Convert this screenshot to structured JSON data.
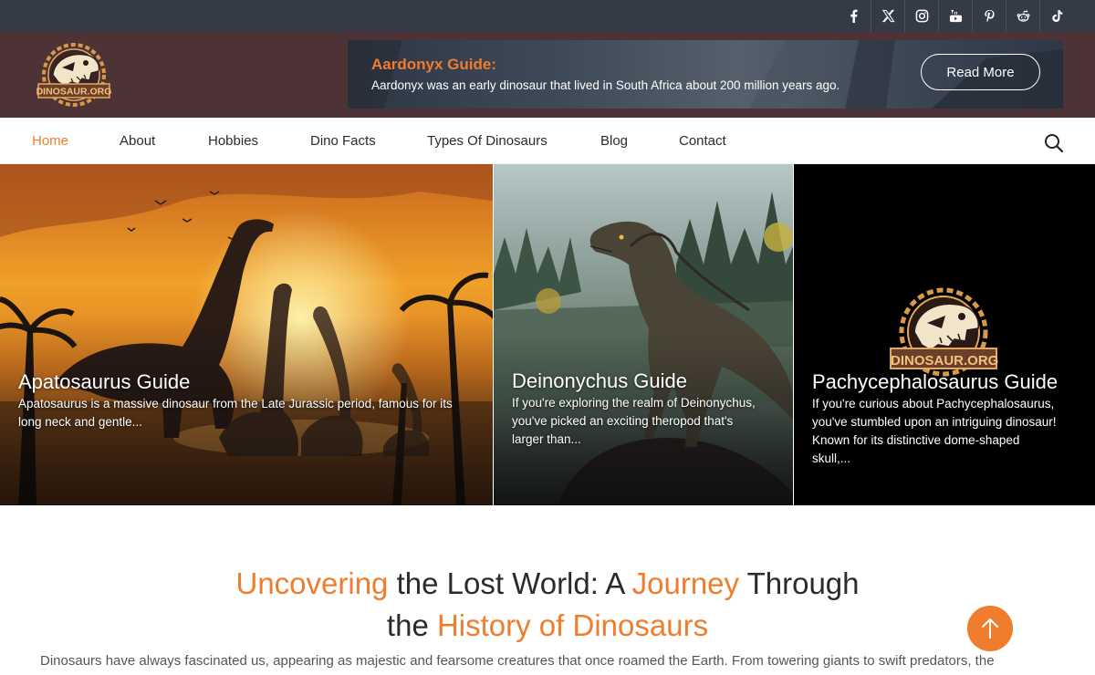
{
  "social": [
    "facebook-icon",
    "x-icon",
    "instagram-icon",
    "youtube-icon",
    "pinterest-icon",
    "reddit-icon",
    "tiktok-icon"
  ],
  "logo": {
    "text": "DINOSAUR.ORG"
  },
  "banner": {
    "title": "Aardonyx Guide:",
    "text": "Aardonyx was an early dinosaur that lived in South Africa about 200 million years ago.",
    "button": "Read More"
  },
  "nav": {
    "items": [
      "Home",
      "About",
      "Hobbies",
      "Dino Facts",
      "Types Of Dinosaurs",
      "Blog",
      "Contact"
    ],
    "active": "Home"
  },
  "cards": [
    {
      "title": "Apatosaurus Guide",
      "desc": "Apatosaurus is a massive dinosaur from the Late Jurassic period, famous for its long neck and gentle..."
    },
    {
      "title": "Deinonychus Guide",
      "desc": "If you're exploring the realm of Deinonychus, you've picked an exciting theropod that's larger than..."
    },
    {
      "title": "Pachycephalosaurus Guide",
      "desc": "If you're curious about Pachycephalosaurus, you've stumbled upon an intriguing dinosaur! Known for its distinctive dome-shaped skull,..."
    }
  ],
  "headline": {
    "part1": "Uncovering",
    "part2": " the Lost World: A ",
    "part3": "Journey",
    "part4": " Through",
    "part5": "the ",
    "part6": "History of Dinosaurs"
  },
  "intro": "Dinosaurs have always fascinated us, appearing as majestic and fearsome creatures that once roamed the Earth. From towering giants to swift predators, the",
  "colors": {
    "accent": "#f07c2d",
    "topbar": "#343a46",
    "header": "#4e3336"
  }
}
